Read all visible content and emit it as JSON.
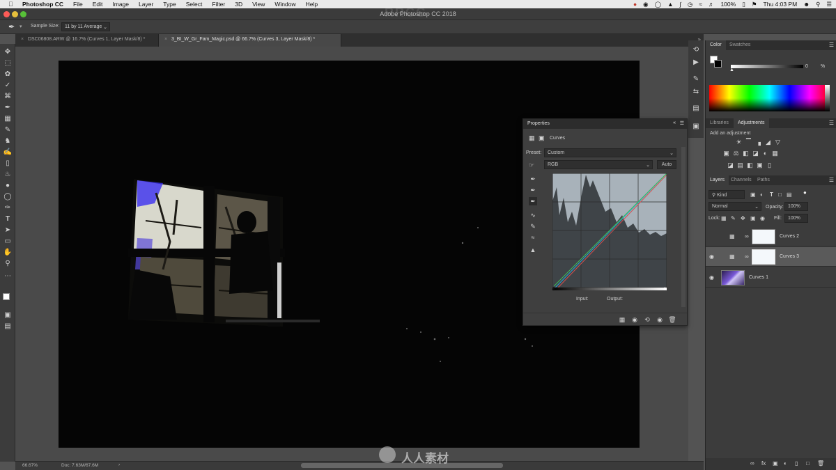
{
  "menubar": {
    "app": "Photoshop CC",
    "items": [
      "File",
      "Edit",
      "Image",
      "Layer",
      "Type",
      "Select",
      "Filter",
      "3D",
      "View",
      "Window",
      "Help"
    ],
    "battery": "100%",
    "clock": "Thu 4:03 PM"
  },
  "window": {
    "title": "Adobe Photoshop CC 2018"
  },
  "options": {
    "sample_size_label": "Sample Size:",
    "sample_size_value": "11 by 11 Average"
  },
  "tabs": [
    {
      "label": "DSC06808.ARW @ 16.7% (Curves 1, Layer Mask/8) *"
    },
    {
      "label": "3_BI_W_Gr_Fam_Magic.psd @ 66.7% (Curves 3, Layer Mask/8) *"
    }
  ],
  "status": {
    "zoom": "66.67%",
    "doc": "Doc: 7.63M/67.6M"
  },
  "color_panel": {
    "tabs": [
      "Color",
      "Swatches"
    ],
    "value": "0",
    "unit": "%"
  },
  "libraries_panel": {
    "tabs": [
      "Libraries",
      "Adjustments"
    ],
    "add_label": "Add an adjustment"
  },
  "layers_panel": {
    "tabs": [
      "Layers",
      "Channels",
      "Paths"
    ],
    "kind": "Kind",
    "blend_mode": "Normal",
    "opacity_label": "Opacity:",
    "opacity_value": "100%",
    "lock_label": "Lock:",
    "fill_label": "Fill:",
    "fill_value": "100%",
    "layers": [
      {
        "name": "Curves 2",
        "visible": false,
        "selected": false
      },
      {
        "name": "Curves 3",
        "visible": true,
        "selected": true
      },
      {
        "name": "Curves 1",
        "visible": true,
        "selected": false
      }
    ]
  },
  "properties": {
    "title": "Properties",
    "panel_name": "Curves",
    "preset_label": "Preset:",
    "preset_value": "Custom",
    "channel_value": "RGB",
    "auto_label": "Auto",
    "input_label": "Input:",
    "output_label": "Output:"
  },
  "watermark": {
    "brand": "RRCG",
    "cn": "人人素材"
  },
  "colors": {
    "accent_selected": "#5a5a5a",
    "foreground": "#ffffff",
    "background": "#000000"
  }
}
